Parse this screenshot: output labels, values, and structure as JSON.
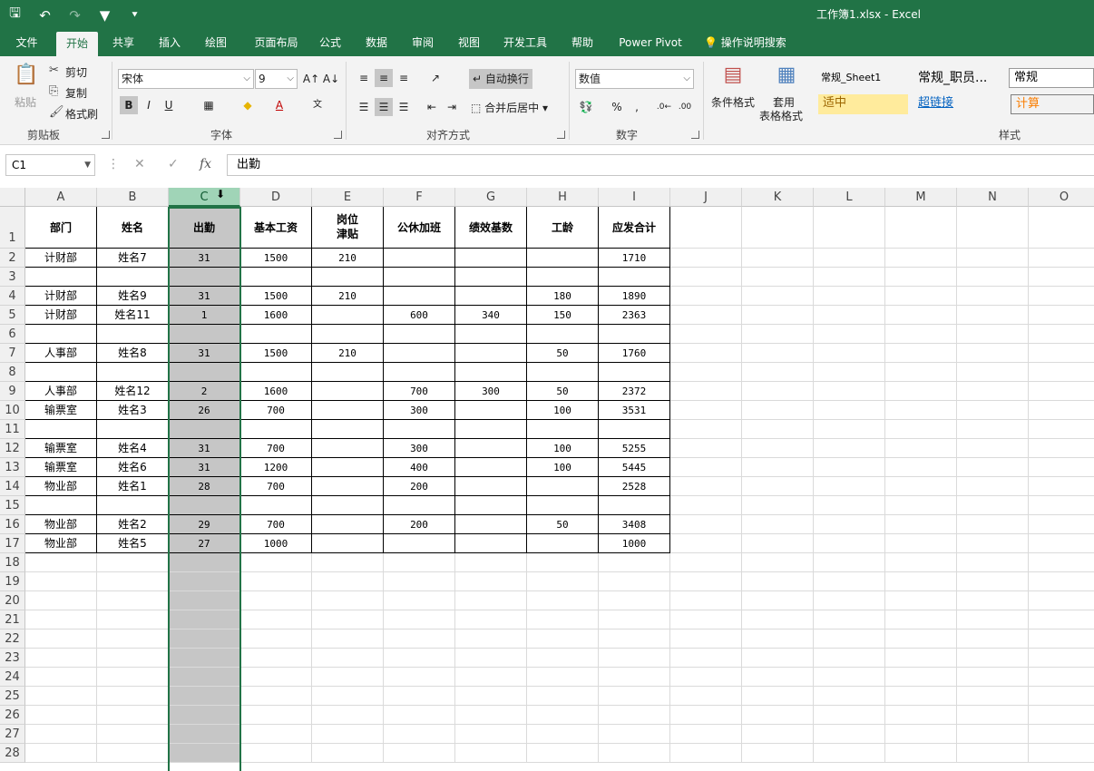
{
  "window": {
    "title": "工作簿1.xlsx  -  Excel"
  },
  "qat": {
    "save_icon": "save-icon",
    "undo_icon": "undo-icon",
    "redo_icon": "redo-icon",
    "filter_icon": "filter-icon",
    "customize_icon": "customize-icon"
  },
  "tabs": [
    "文件",
    "开始",
    "共享",
    "插入",
    "绘图",
    "页面布局",
    "公式",
    "数据",
    "审阅",
    "视图",
    "开发工具",
    "帮助",
    "Power Pivot",
    "操作说明搜索"
  ],
  "ribbon": {
    "clipboard": {
      "paste": "粘贴",
      "cut": "剪切",
      "copy": "复制",
      "format_painter": "格式刷",
      "label": "剪贴板"
    },
    "font": {
      "name": "宋体",
      "size": "9",
      "bold": "B",
      "italic": "I",
      "underline": "U",
      "label": "字体",
      "wen": "wén\n文"
    },
    "alignment": {
      "wrap_text": "自动换行",
      "merge_center": "合并后居中",
      "label": "对齐方式"
    },
    "number": {
      "format": "数值",
      "label": "数字",
      "percent": "%",
      "comma": ","
    },
    "styles": {
      "conditional": "条件格式",
      "table_format_1": "套用",
      "table_format_2": "表格格式",
      "label": "样式",
      "cells": [
        "常规_Sheet1",
        "常规_职员...",
        "常规",
        "适中",
        "超链接",
        "计算"
      ]
    }
  },
  "formula_bar": {
    "name_box": "C1",
    "content": "出勤",
    "fx": "fx"
  },
  "columns": [
    "A",
    "B",
    "C",
    "D",
    "E",
    "F",
    "G",
    "H",
    "I",
    "J",
    "K",
    "L",
    "M",
    "N",
    "O"
  ],
  "rows": [
    "1",
    "2",
    "3",
    "4",
    "5",
    "6",
    "7",
    "8",
    "9",
    "10",
    "11",
    "12",
    "13",
    "14",
    "15",
    "16",
    "17",
    "18",
    "19",
    "20",
    "21",
    "22",
    "23",
    "24",
    "25",
    "26",
    "27",
    "28"
  ],
  "sheet": {
    "headers": [
      "部门",
      "姓名",
      "出勤",
      "基本工资",
      "岗位\n津贴",
      "公休加班",
      "绩效基数",
      "工龄",
      "应发合计"
    ],
    "data": [
      [
        "计财部",
        "姓名7",
        "31",
        "1500",
        "210",
        "",
        "",
        "",
        "1710"
      ],
      [
        "",
        "",
        "",
        "",
        "",
        "",
        "",
        "",
        ""
      ],
      [
        "计财部",
        "姓名9",
        "31",
        "1500",
        "210",
        "",
        "",
        "180",
        "1890"
      ],
      [
        "计财部",
        "姓名11",
        "1",
        "1600",
        "",
        "600",
        "340",
        "150",
        "2363"
      ],
      [
        "",
        "",
        "",
        "",
        "",
        "",
        "",
        "",
        ""
      ],
      [
        "人事部",
        "姓名8",
        "31",
        "1500",
        "210",
        "",
        "",
        "50",
        "1760"
      ],
      [
        "",
        "",
        "",
        "",
        "",
        "",
        "",
        "",
        ""
      ],
      [
        "人事部",
        "姓名12",
        "2",
        "1600",
        "",
        "700",
        "300",
        "50",
        "2372"
      ],
      [
        "输票室",
        "姓名3",
        "26",
        "700",
        "",
        "300",
        "",
        "100",
        "3531"
      ],
      [
        "",
        "",
        "",
        "",
        "",
        "",
        "",
        "",
        ""
      ],
      [
        "输票室",
        "姓名4",
        "31",
        "700",
        "",
        "300",
        "",
        "100",
        "5255"
      ],
      [
        "输票室",
        "姓名6",
        "31",
        "1200",
        "",
        "400",
        "",
        "100",
        "5445"
      ],
      [
        "物业部",
        "姓名1",
        "28",
        "700",
        "",
        "200",
        "",
        "",
        "2528"
      ],
      [
        "",
        "",
        "",
        "",
        "",
        "",
        "",
        "",
        ""
      ],
      [
        "物业部",
        "姓名2",
        "29",
        "700",
        "",
        "200",
        "",
        "50",
        "3408"
      ],
      [
        "物业部",
        "姓名5",
        "27",
        "1000",
        "",
        "",
        "",
        "",
        "1000"
      ]
    ]
  },
  "selection": {
    "column": "C"
  },
  "colors": {
    "brand": "#217346",
    "selected_column_fill": "#c6c6c6",
    "header_selected": "#a0d4b7"
  }
}
